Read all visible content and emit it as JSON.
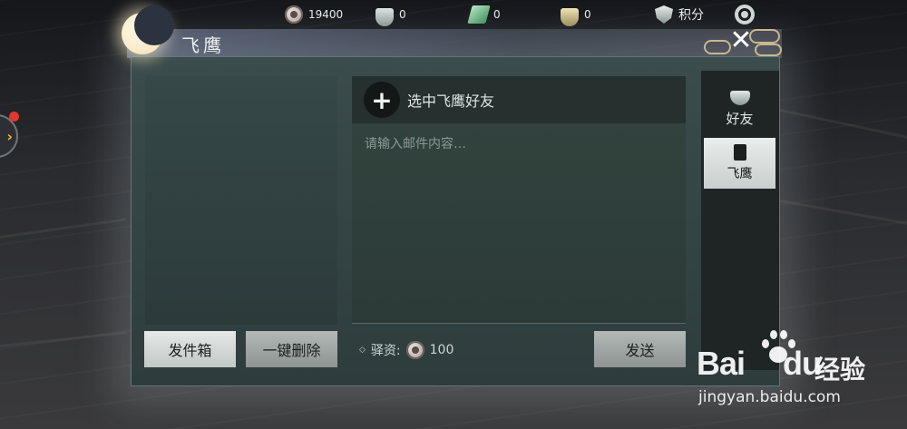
{
  "topbar": {
    "currencies": [
      {
        "icon": "copper-coin-icon",
        "value": "19400"
      },
      {
        "icon": "silver-bowl-icon",
        "value": "0"
      },
      {
        "icon": "jade-icon",
        "value": "0"
      },
      {
        "icon": "gold-bowl-icon",
        "value": "0"
      }
    ],
    "points_label": "积分",
    "settings_icon": "gear-icon"
  },
  "window": {
    "title": "飞鹰",
    "close_label": "✕"
  },
  "left_panel": {
    "outbox_button": "发件箱",
    "delete_all_button": "一键删除"
  },
  "compose": {
    "plus_label": "+",
    "select_friend_label": "选中飞鹰好友",
    "content_placeholder": "请输入邮件内容…",
    "fee_label": "驿资:",
    "fee_value": "100",
    "send_button": "发送"
  },
  "tabs": [
    {
      "label": "好友",
      "icon": "bowl-icon",
      "active": false
    },
    {
      "label": "飞鹰",
      "icon": "scroll-icon",
      "active": true
    }
  ],
  "side": {
    "expand_arrow": "›"
  },
  "watermark": {
    "logo_bai": "Bai",
    "logo_du": "du",
    "logo_cn": "经验",
    "url": "jingyan.baidu.com"
  },
  "colors": {
    "accent_orange": "#f2b33b",
    "notification_red": "#e2372f",
    "panel_teal": "#33453f"
  }
}
